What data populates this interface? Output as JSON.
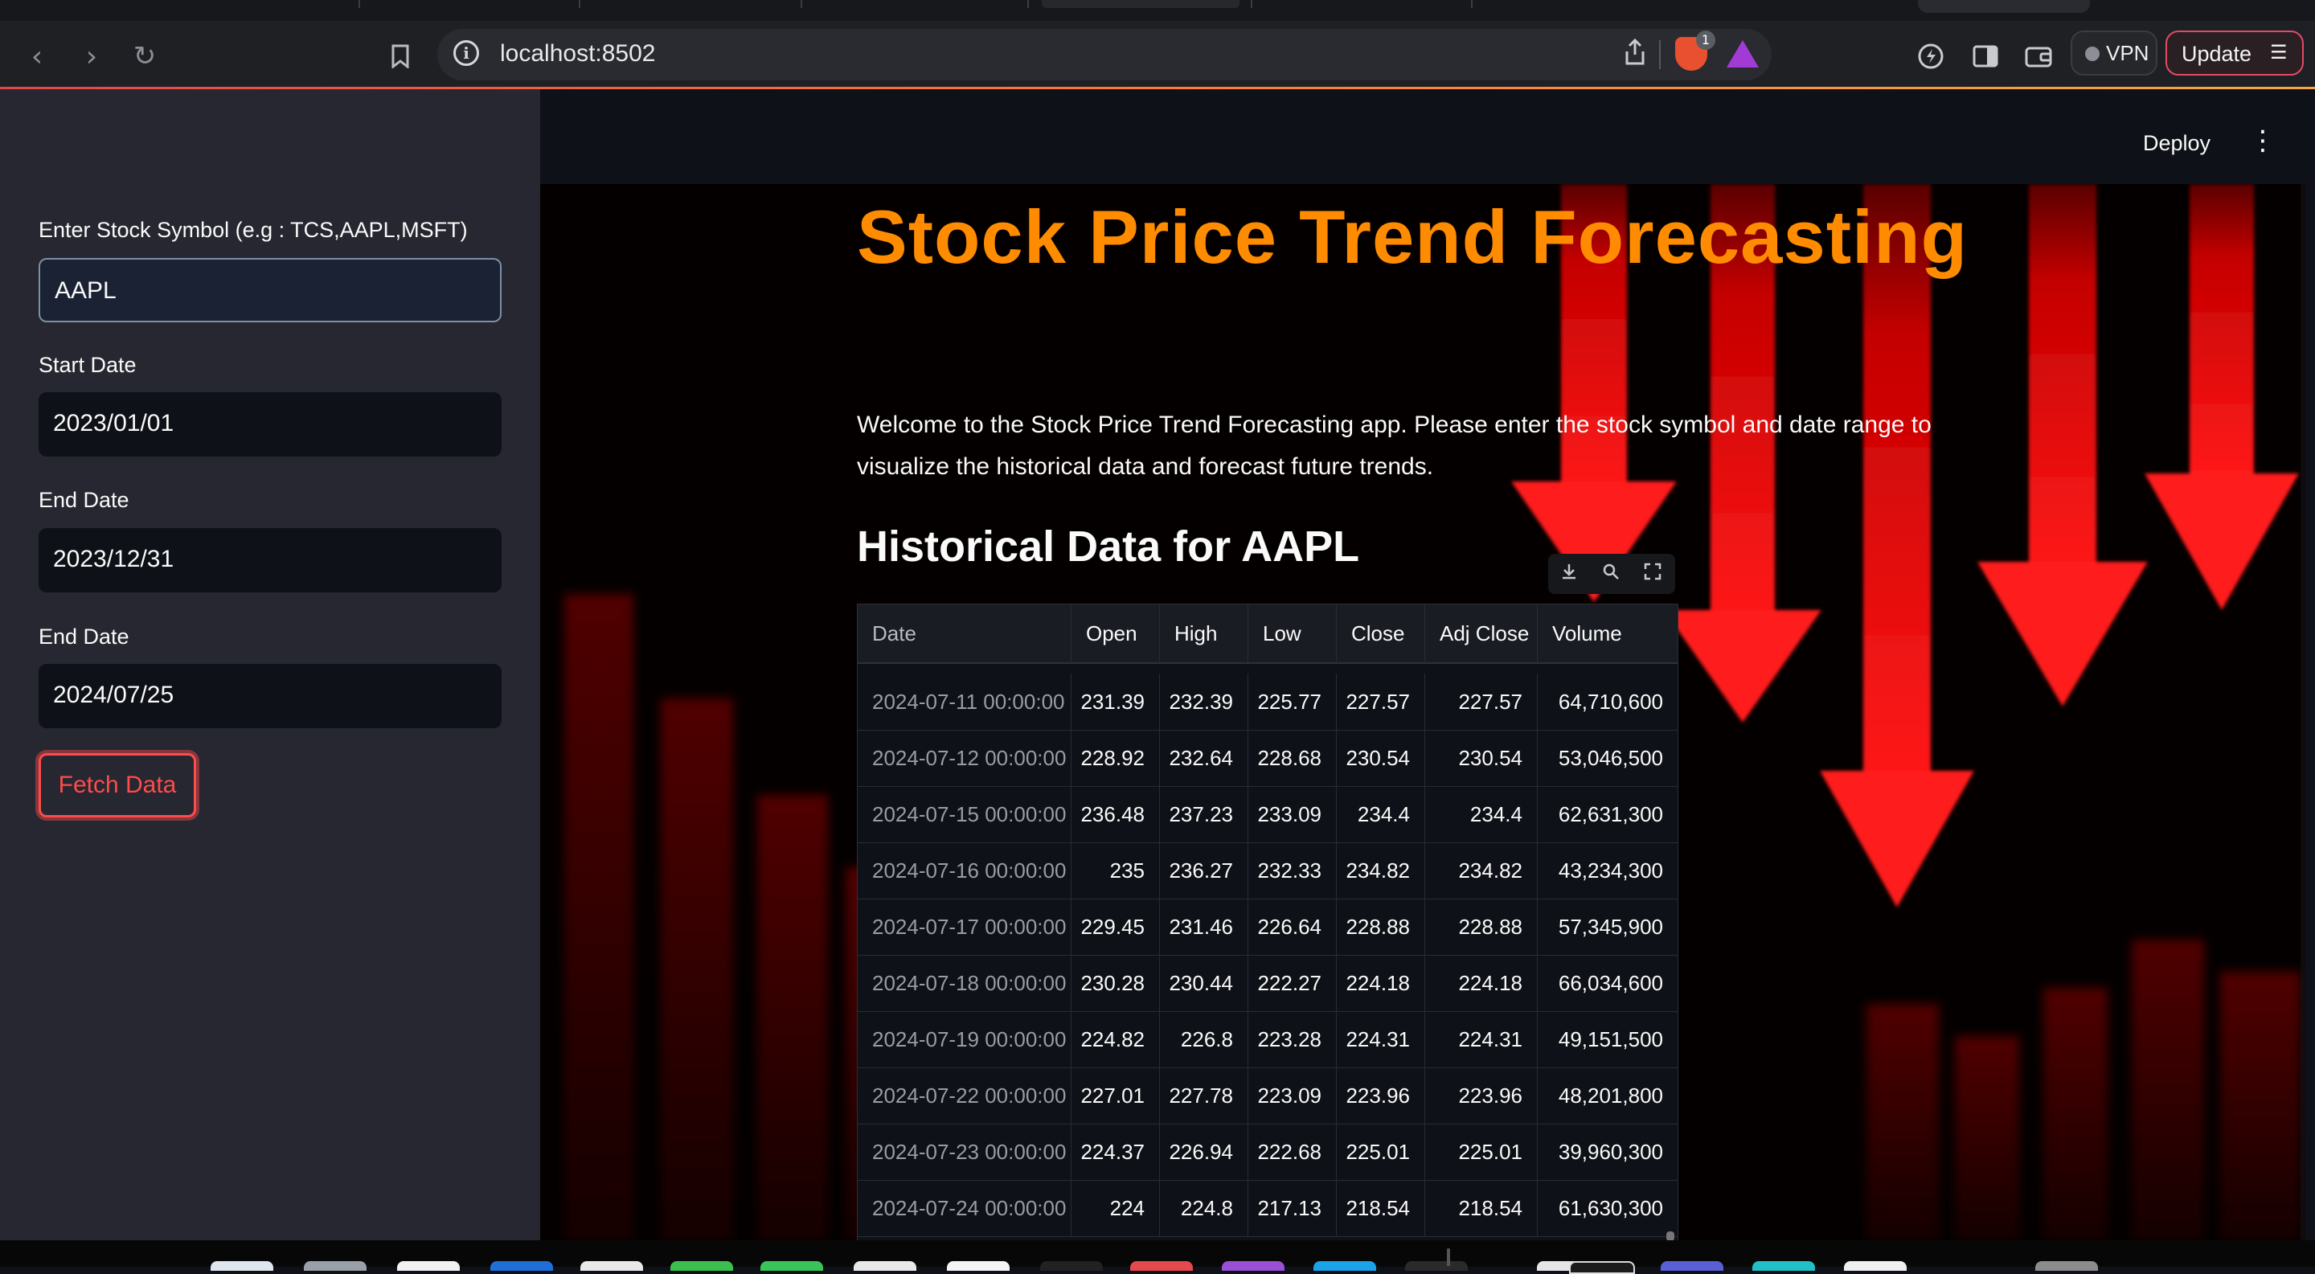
{
  "browser": {
    "url": "localhost:8502",
    "brave_badge_count": "1",
    "vpn_label": "VPN",
    "update_label": "Update"
  },
  "header": {
    "deploy_label": "Deploy"
  },
  "sidebar": {
    "symbol_label": "Enter Stock Symbol (e.g : TCS,AAPL,MSFT)",
    "symbol_value": "AAPL",
    "start_label": "Start Date",
    "start_value": "2023/01/01",
    "end_label_1": "End Date",
    "end_value_1": "2023/12/31",
    "end_label_2": "End Date",
    "end_value_2": "2024/07/25",
    "fetch_label": "Fetch Data"
  },
  "main": {
    "title": "Stock Price Trend Forecasting",
    "intro_line1": "Welcome to the Stock Price Trend Forecasting app. Please enter the stock symbol and date range to",
    "intro_line2": "visualize the historical data and forecast future trends.",
    "subheading": "Historical Data for AAPL"
  },
  "table": {
    "columns": [
      "Date",
      "Open",
      "High",
      "Low",
      "Close",
      "Adj Close",
      "Volume"
    ],
    "rows": [
      [
        "2024-07-11 00:00:00",
        "231.39",
        "232.39",
        "225.77",
        "227.57",
        "227.57",
        "64,710,600"
      ],
      [
        "2024-07-12 00:00:00",
        "228.92",
        "232.64",
        "228.68",
        "230.54",
        "230.54",
        "53,046,500"
      ],
      [
        "2024-07-15 00:00:00",
        "236.48",
        "237.23",
        "233.09",
        "234.4",
        "234.4",
        "62,631,300"
      ],
      [
        "2024-07-16 00:00:00",
        "235",
        "236.27",
        "232.33",
        "234.82",
        "234.82",
        "43,234,300"
      ],
      [
        "2024-07-17 00:00:00",
        "229.45",
        "231.46",
        "226.64",
        "228.88",
        "228.88",
        "57,345,900"
      ],
      [
        "2024-07-18 00:00:00",
        "230.28",
        "230.44",
        "222.27",
        "224.18",
        "224.18",
        "66,034,600"
      ],
      [
        "2024-07-19 00:00:00",
        "224.82",
        "226.8",
        "223.28",
        "224.31",
        "224.31",
        "49,151,500"
      ],
      [
        "2024-07-22 00:00:00",
        "227.01",
        "227.78",
        "223.09",
        "223.96",
        "223.96",
        "48,201,800"
      ],
      [
        "2024-07-23 00:00:00",
        "224.37",
        "226.94",
        "222.68",
        "225.01",
        "225.01",
        "39,960,300"
      ],
      [
        "2024-07-24 00:00:00",
        "224",
        "224.8",
        "217.13",
        "218.54",
        "218.54",
        "61,630,300"
      ]
    ]
  },
  "colors": {
    "accent": "#ff8c00",
    "primary_button": "#ff4b4b",
    "sidebar_bg": "#262730",
    "app_bg": "#0e1117"
  }
}
